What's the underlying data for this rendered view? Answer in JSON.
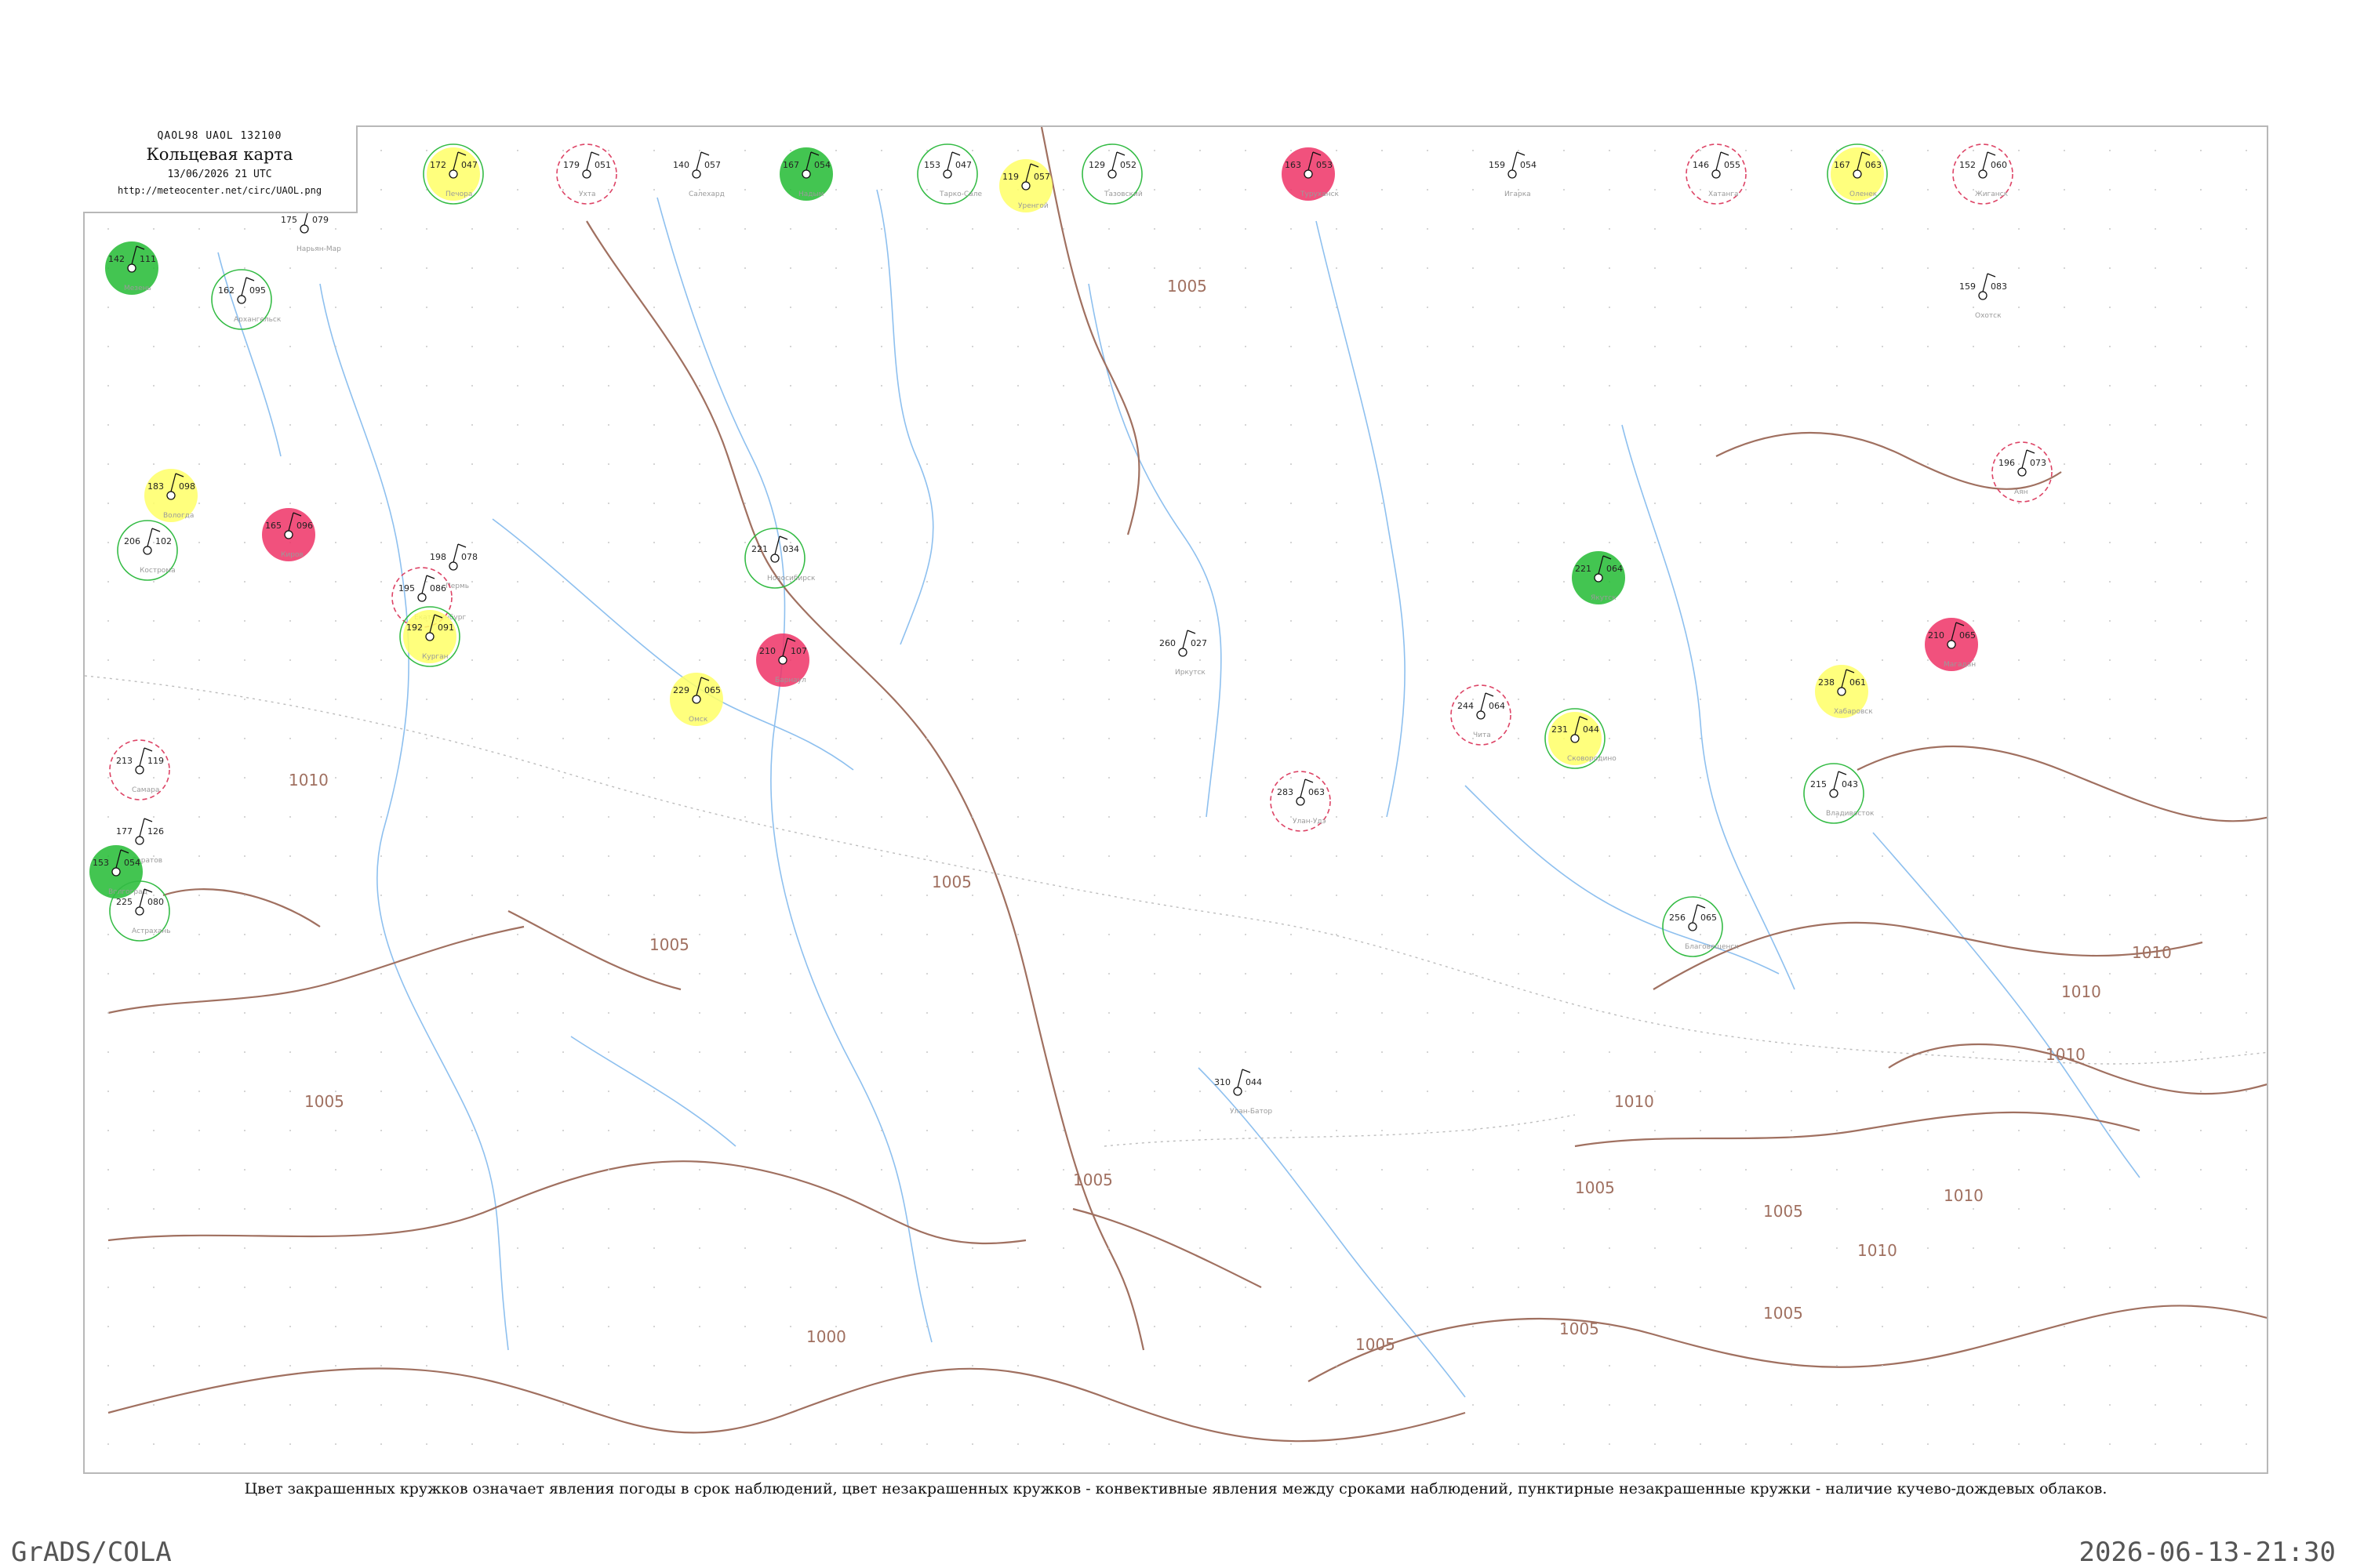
{
  "header": {
    "codes": "QAOL98  UAOL  132100",
    "title": "Кольцевая карта",
    "datetime": "13/06/2026 21 UTC",
    "url": "http://meteocenter.net/circ/UAOL.png"
  },
  "caption": "Цвет закрашенных кружков означает явления погоды в срок наблюдений, цвет незакрашенных кружков - конвективные явления между сроками наблюдений, пунктирные незакрашенные кружки - наличие кучево-дождевых облаков.",
  "footer": {
    "software": "GrADS/COLA",
    "generated": "2026-06-13-21:30"
  },
  "colors": {
    "isobar": "#a07060",
    "river": "#8ec0ef",
    "fill_yellow": "#ffff66",
    "fill_red": "#ee3366",
    "fill_green": "#22bb33",
    "ring_red": "#dd4466",
    "ring_green": "#33bb44"
  },
  "isobar_labels": [
    "1005",
    "1005",
    "1005",
    "1005",
    "1005",
    "1005",
    "1005",
    "1005",
    "1005",
    "1005",
    "1000",
    "1010",
    "1010",
    "1010",
    "1010",
    "1010",
    "1010",
    "1010"
  ],
  "stations": [
    {
      "t": "172",
      "p": "047",
      "name": "Печора"
    },
    {
      "t": "179",
      "p": "051",
      "name": "Ухта"
    },
    {
      "t": "140",
      "p": "057",
      "name": "Салехард"
    },
    {
      "t": "167",
      "p": "054",
      "name": "Надым"
    },
    {
      "t": "153",
      "p": "047",
      "name": "Тарко-Сале"
    },
    {
      "t": "119",
      "p": "057",
      "name": "Уренгой"
    },
    {
      "t": "129",
      "p": "052",
      "name": "Тазовский"
    },
    {
      "t": "163",
      "p": "053",
      "name": "Туруханск"
    },
    {
      "t": "159",
      "p": "054",
      "name": "Игарка"
    },
    {
      "t": "146",
      "p": "055",
      "name": "Хатанга"
    },
    {
      "t": "167",
      "p": "063",
      "name": "Оленек"
    },
    {
      "t": "152",
      "p": "060",
      "name": "Жиганск"
    },
    {
      "t": "175",
      "p": "079",
      "name": "Нарьян-Мар"
    },
    {
      "t": "142",
      "p": "111",
      "name": "Мезень"
    },
    {
      "t": "162",
      "p": "095",
      "name": "Архангельск"
    },
    {
      "t": "183",
      "p": "098",
      "name": "Вологда"
    },
    {
      "t": "206",
      "p": "102",
      "name": "Кострома"
    },
    {
      "t": "165",
      "p": "096",
      "name": "Киров"
    },
    {
      "t": "198",
      "p": "078",
      "name": "Пермь"
    },
    {
      "t": "195",
      "p": "086",
      "name": "Екатеринбург"
    },
    {
      "t": "192",
      "p": "091",
      "name": "Курган"
    },
    {
      "t": "213",
      "p": "119",
      "name": "Самара"
    },
    {
      "t": "177",
      "p": "126",
      "name": "Саратов"
    },
    {
      "t": "153",
      "p": "054",
      "name": "Волгоград"
    },
    {
      "t": "225",
      "p": "080",
      "name": "Астрахань"
    },
    {
      "t": "229",
      "p": "065",
      "name": "Омск"
    },
    {
      "t": "221",
      "p": "034",
      "name": "Новосибирск"
    },
    {
      "t": "210",
      "p": "107",
      "name": "Барнаул"
    },
    {
      "t": "260",
      "p": "027",
      "name": "Иркутск"
    },
    {
      "t": "244",
      "p": "064",
      "name": "Чита"
    },
    {
      "t": "231",
      "p": "044",
      "name": "Сковородино"
    },
    {
      "t": "283",
      "p": "063",
      "name": "Улан-Удэ"
    },
    {
      "t": "310",
      "p": "044",
      "name": "Улан-Батор"
    },
    {
      "t": "221",
      "p": "064",
      "name": "Якутск"
    },
    {
      "t": "256",
      "p": "065",
      "name": "Благовещенск"
    },
    {
      "t": "238",
      "p": "061",
      "name": "Хабаровск"
    },
    {
      "t": "215",
      "p": "043",
      "name": "Владивосток"
    },
    {
      "t": "210",
      "p": "065",
      "name": "Магадан"
    },
    {
      "t": "159",
      "p": "083",
      "name": "Охотск"
    },
    {
      "t": "196",
      "p": "073",
      "name": "Аян"
    }
  ]
}
